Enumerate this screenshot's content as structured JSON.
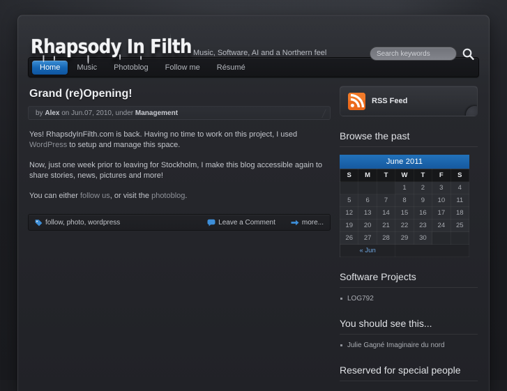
{
  "site": {
    "logo": "Rhapsody In Filth",
    "tagline": "Music, Software, AI and a Northern feel"
  },
  "search": {
    "placeholder": "Search keywords",
    "value": "",
    "icon": "search-icon"
  },
  "nav": {
    "items": [
      {
        "label": "Home",
        "active": true
      },
      {
        "label": "Music",
        "active": false
      },
      {
        "label": "Photoblog",
        "active": false
      },
      {
        "label": "Follow me",
        "active": false
      },
      {
        "label": "Résumé",
        "active": false
      }
    ]
  },
  "post": {
    "title": "Grand (re)Opening!",
    "meta": {
      "by": "by",
      "author": "Alex",
      "on": "on",
      "date": "Jun.07, 2010,",
      "under": "under",
      "category": "Management"
    },
    "paragraphs": [
      {
        "parts": [
          {
            "text": "Yes! RhapsdyInFilth.com is back. Having no time to work on this project, I used ",
            "link": false
          },
          {
            "text": "WordPress",
            "link": true
          },
          {
            "text": " to setup and manage this space.",
            "link": false
          }
        ]
      },
      {
        "parts": [
          {
            "text": "Now, just one week prior to leaving for Stockholm, I make this blog accessible again to share stories, news, pictures and more!",
            "link": false
          }
        ]
      },
      {
        "parts": [
          {
            "text": "You can either ",
            "link": false
          },
          {
            "text": "follow us",
            "link": true
          },
          {
            "text": ", or visit the ",
            "link": false
          },
          {
            "text": "photoblog",
            "link": true
          },
          {
            "text": ".",
            "link": false
          }
        ]
      }
    ],
    "footer": {
      "tags_icon": "tag-icon",
      "tags": "follow, photo, wordpress",
      "comment_icon": "comment-bubble-icon",
      "comment_label": "Leave a Comment",
      "more_icon": "arrow-right-icon",
      "more_label": "more..."
    }
  },
  "sidebar": {
    "rss": {
      "icon": "rss-icon",
      "label": "RSS Feed"
    },
    "browse_heading": "Browse the past",
    "calendar": {
      "caption": "June 2011",
      "weekdays": [
        "S",
        "M",
        "T",
        "W",
        "T",
        "F",
        "S"
      ],
      "leading_blanks": 3,
      "days": [
        1,
        2,
        3,
        4,
        5,
        6,
        7,
        8,
        9,
        10,
        11,
        12,
        13,
        14,
        15,
        16,
        17,
        18,
        19,
        20,
        21,
        22,
        23,
        24,
        25,
        26,
        27,
        28,
        29,
        30
      ],
      "prev_label": "« Jun"
    },
    "sections": [
      {
        "heading": "Software Projects",
        "items": [
          "LOG792"
        ]
      },
      {
        "heading": "You should see this...",
        "items": [
          "Julie Gagné Imaginaire du nord"
        ]
      },
      {
        "heading": "Reserved for special people",
        "items": []
      }
    ]
  },
  "colors": {
    "accent_blue": "#1667b4",
    "rss_orange": "#ec6a1c",
    "page_bg": "#1c1d21",
    "panel_bg": "#27282d",
    "text": "#c2c5cb"
  }
}
